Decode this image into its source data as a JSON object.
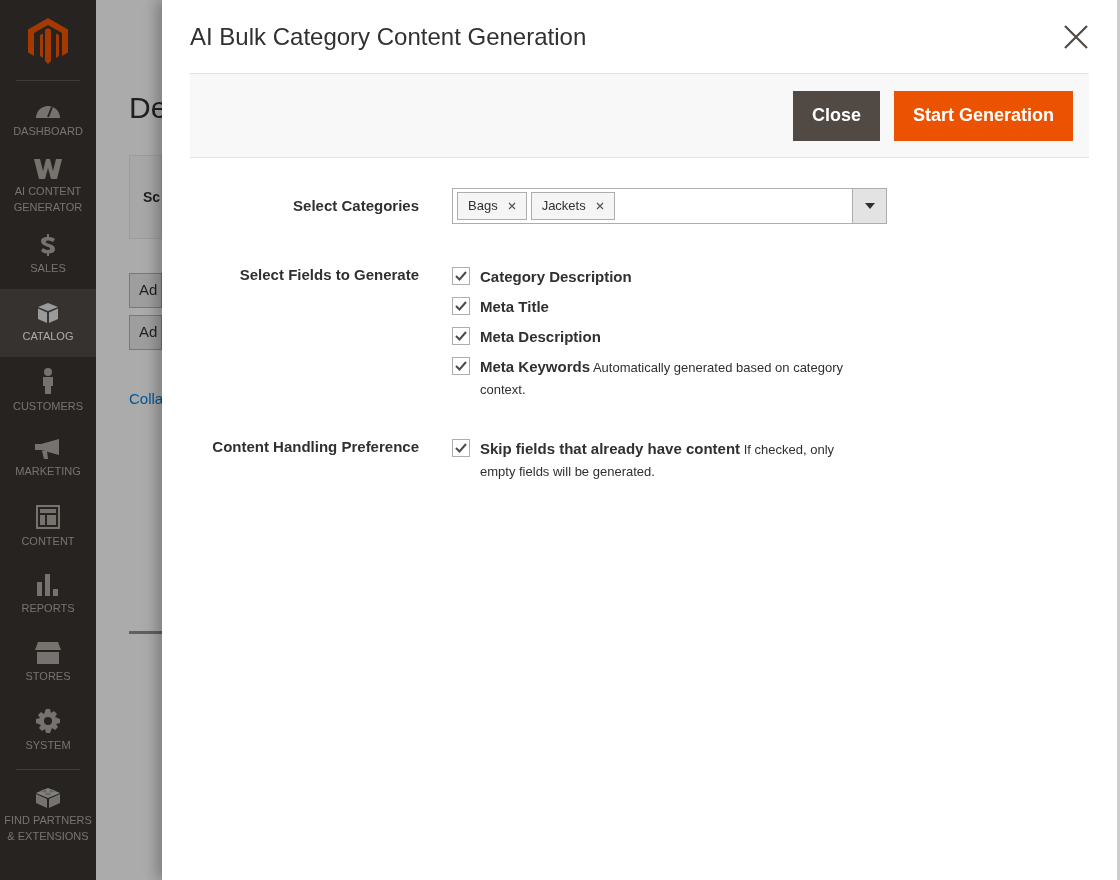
{
  "sidebar": {
    "items": [
      {
        "kind": "dashboard",
        "label": "DASHBOARD",
        "selected": false
      },
      {
        "kind": "ai",
        "label": "AI CONTENT GENERATOR",
        "selected": false
      },
      {
        "kind": "sales",
        "label": "SALES",
        "selected": false
      },
      {
        "kind": "catalog",
        "label": "CATALOG",
        "selected": true
      },
      {
        "kind": "customers",
        "label": "CUSTOMERS",
        "selected": false
      },
      {
        "kind": "marketing",
        "label": "MARKETING",
        "selected": false
      },
      {
        "kind": "content",
        "label": "CONTENT",
        "selected": false
      },
      {
        "kind": "reports",
        "label": "REPORTS",
        "selected": false
      },
      {
        "kind": "stores",
        "label": "STORES",
        "selected": false
      },
      {
        "kind": "system",
        "label": "SYSTEM",
        "selected": false
      },
      {
        "kind": "partners",
        "label": "FIND PARTNERS & EXTENSIONS",
        "selected": false
      }
    ]
  },
  "background_page": {
    "heading": "De",
    "scope_label": "Sc",
    "buttons": [
      "Ad",
      "Ad"
    ],
    "link": "Colla"
  },
  "modal": {
    "title": "AI Bulk Category Content Generation",
    "actions": [
      {
        "kind": "secondary",
        "label": "Close"
      },
      {
        "kind": "primary",
        "label": "Start Generation"
      }
    ],
    "categories": {
      "label": "Select Categories",
      "chips": [
        "Bags",
        "Jackets"
      ]
    },
    "fields": {
      "label": "Select Fields to Generate",
      "options": [
        {
          "label": "Category Description",
          "checked": true
        },
        {
          "label": "Meta Title",
          "checked": true
        },
        {
          "label": "Meta Description",
          "checked": true
        },
        {
          "label": "Meta Keywords",
          "note": "Automatically generated based on category context.",
          "checked": true
        }
      ]
    },
    "handling": {
      "label": "Content Handling Preference",
      "options": [
        {
          "label": "Skip fields that already have content",
          "note": "If checked, only empty fields will be generated.",
          "checked": true
        }
      ]
    }
  }
}
